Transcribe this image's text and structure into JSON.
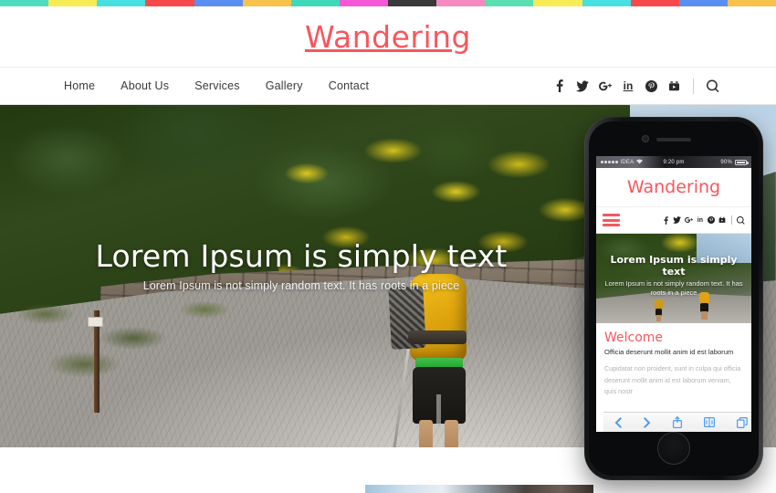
{
  "brand": {
    "name": "Wandering",
    "accent_color": "#f8565d"
  },
  "topbar": {
    "colors": [
      "#4ddcc0",
      "#f7ec54",
      "#46e0e0",
      "#f8494a",
      "#5a8ef0",
      "#f9c24a",
      "#3ed9bb",
      "#f558d6",
      "#3a3a3a",
      "#f58ac0",
      "#59dfb0",
      "#f7ec54",
      "#46e0e0",
      "#f8494a",
      "#5a8ef0",
      "#f9c24a"
    ]
  },
  "nav": {
    "items": [
      {
        "label": "Home"
      },
      {
        "label": "About Us"
      },
      {
        "label": "Services"
      },
      {
        "label": "Gallery"
      },
      {
        "label": "Contact"
      }
    ],
    "social": [
      {
        "name": "facebook",
        "glyph": "f"
      },
      {
        "name": "twitter",
        "glyph": ""
      },
      {
        "name": "google-plus",
        "glyph": ""
      },
      {
        "name": "linkedin",
        "glyph": "in"
      },
      {
        "name": "pinterest",
        "glyph": ""
      },
      {
        "name": "youtube",
        "glyph": ""
      }
    ],
    "search_label": "Search"
  },
  "hero": {
    "title": "Lorem Ipsum is simply text",
    "subtitle": "Lorem Ipsum is not simply random text. It has roots in a piece"
  },
  "phone": {
    "status": {
      "carrier": "IDEA",
      "time": "9:20 pm",
      "battery": "90%"
    },
    "logo": "Wandering",
    "social": [
      {
        "name": "facebook",
        "glyph": "f"
      },
      {
        "name": "twitter",
        "glyph": ""
      },
      {
        "name": "google-plus",
        "glyph": ""
      },
      {
        "name": "linkedin",
        "glyph": "in"
      },
      {
        "name": "pinterest",
        "glyph": ""
      },
      {
        "name": "youtube",
        "glyph": ""
      }
    ],
    "hero": {
      "title": "Lorem Ipsum is simply text",
      "subtitle": "Lorem Ipsum is not simply random text. It has roots in a piece"
    },
    "welcome": {
      "heading": "Welcome",
      "lead": "Officia deserunt mollit anim id est laborum",
      "body": "Cupidatat non proident, sunt in culpa qui officia deserunt mollit anim id est laborum veniam, quis nostr"
    },
    "toolbar": [
      {
        "name": "back",
        "label": "Back"
      },
      {
        "name": "forward",
        "label": "Forward"
      },
      {
        "name": "share",
        "label": "Share"
      },
      {
        "name": "bookmarks",
        "label": "Bookmarks"
      },
      {
        "name": "tabs",
        "label": "Tabs"
      }
    ]
  }
}
